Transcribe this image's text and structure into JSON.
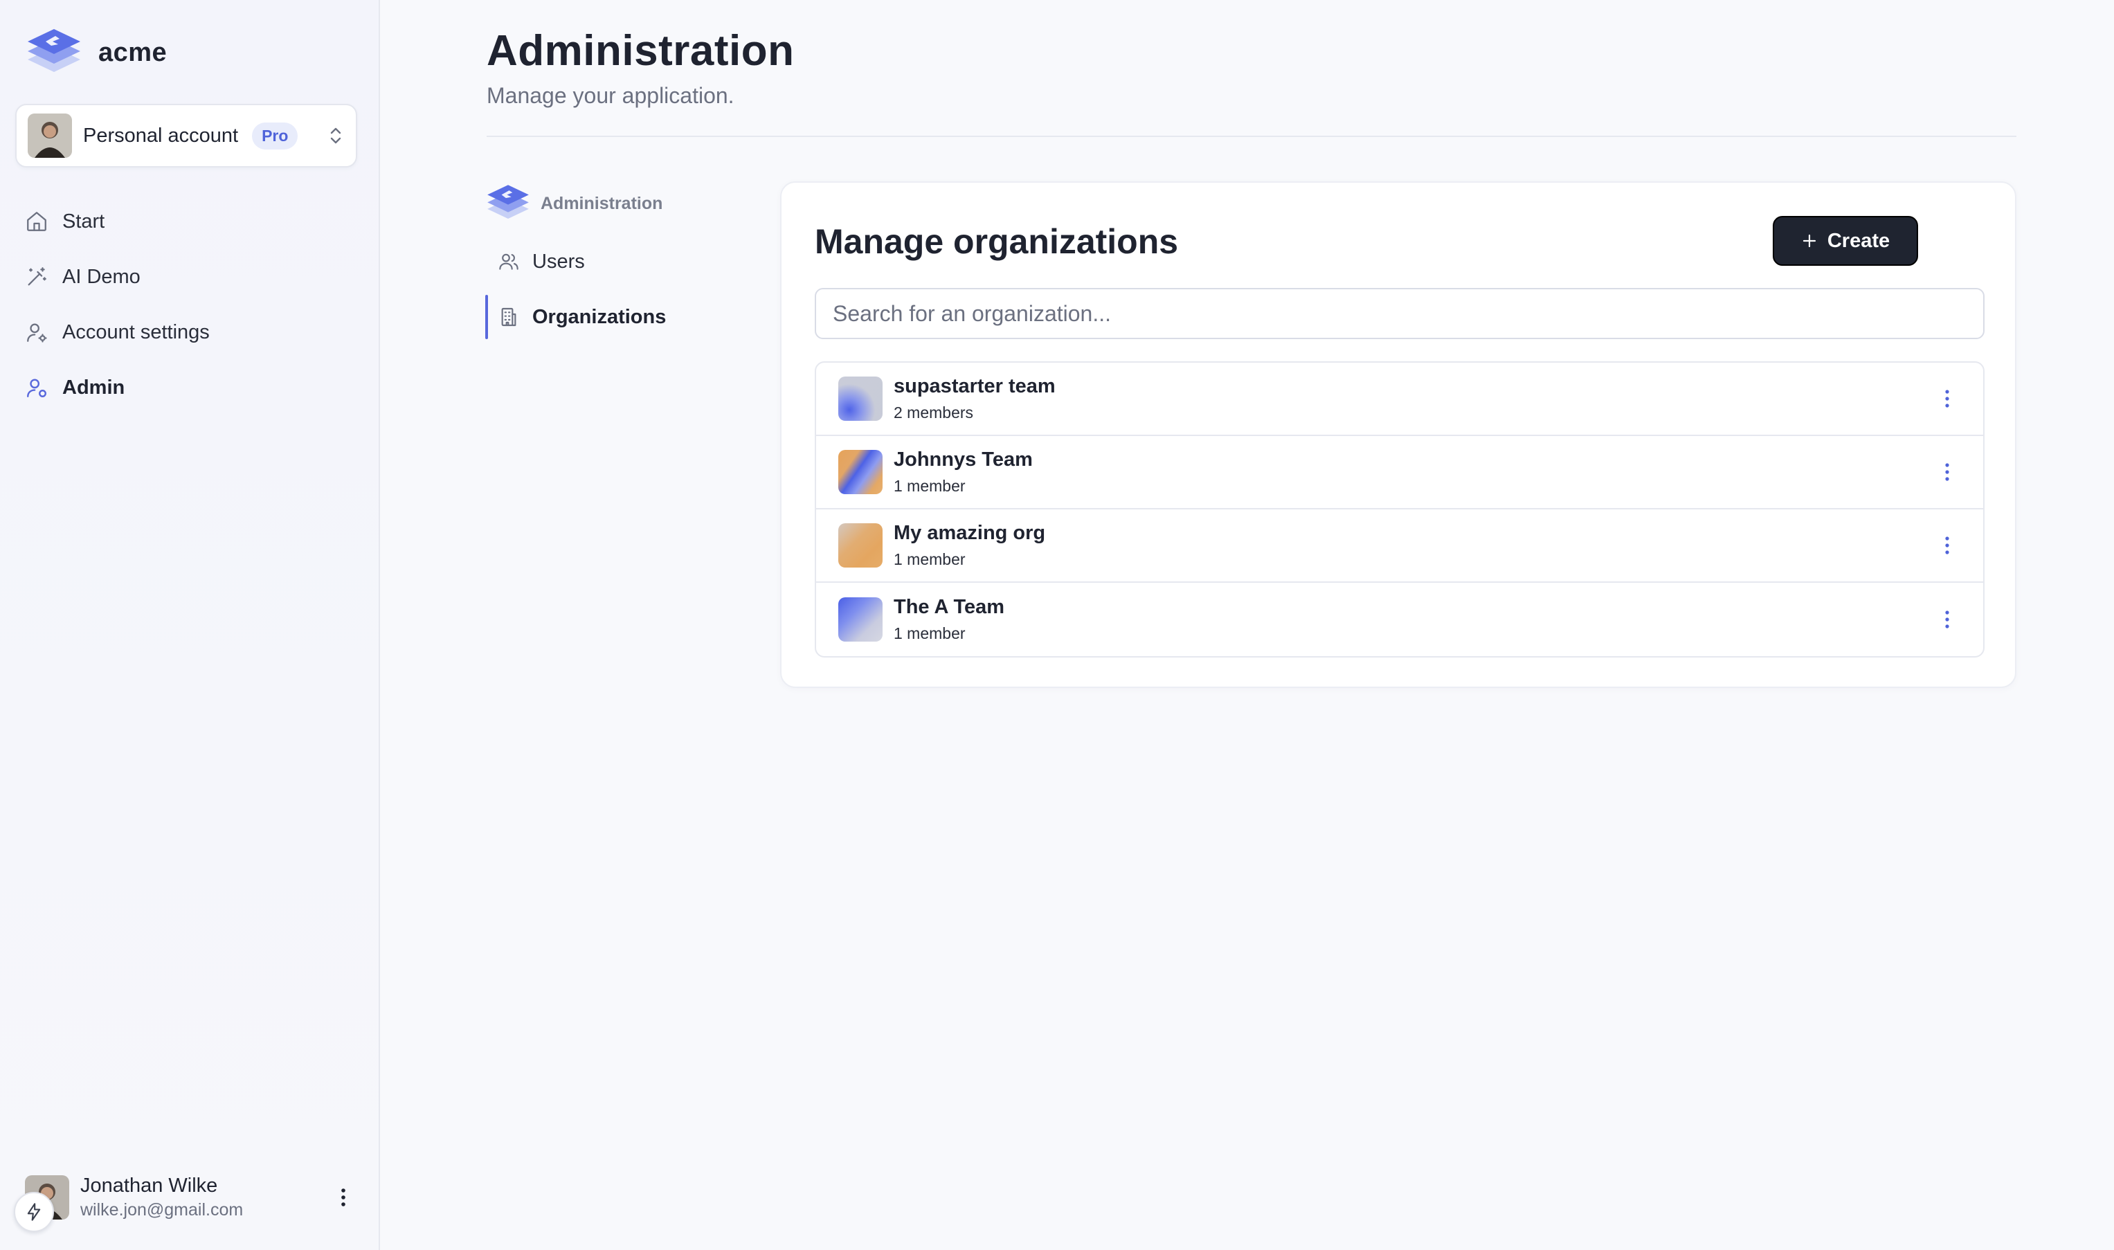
{
  "brand": {
    "name": "acme"
  },
  "account": {
    "label": "Personal account",
    "badge": "Pro"
  },
  "nav": {
    "items": [
      {
        "label": "Start",
        "icon": "home-icon"
      },
      {
        "label": "AI Demo",
        "icon": "magic-wand-icon"
      },
      {
        "label": "Account settings",
        "icon": "user-gear-icon"
      },
      {
        "label": "Admin",
        "icon": "user-admin-icon",
        "active": true
      }
    ]
  },
  "user": {
    "name": "Jonathan Wilke",
    "email": "wilke.jon@gmail.com"
  },
  "page": {
    "title": "Administration",
    "subtitle": "Manage your application."
  },
  "subnav": {
    "header": "Administration",
    "items": [
      {
        "label": "Users",
        "icon": "users-icon"
      },
      {
        "label": "Organizations",
        "icon": "building-icon",
        "active": true
      }
    ]
  },
  "orgs_card": {
    "title": "Manage organizations",
    "create_label": "Create",
    "search_placeholder": "Search for an organization...",
    "organizations": [
      {
        "name": "supastarter team",
        "members": "2 members"
      },
      {
        "name": "Johnnys Team",
        "members": "1 member"
      },
      {
        "name": "My amazing org",
        "members": "1 member"
      },
      {
        "name": "The A Team",
        "members": "1 member"
      }
    ]
  },
  "colors": {
    "accent": "#5868dc",
    "button_dark": "#1f2430",
    "badge_bg": "#e8ecfb",
    "badge_text": "#4f63d9"
  }
}
